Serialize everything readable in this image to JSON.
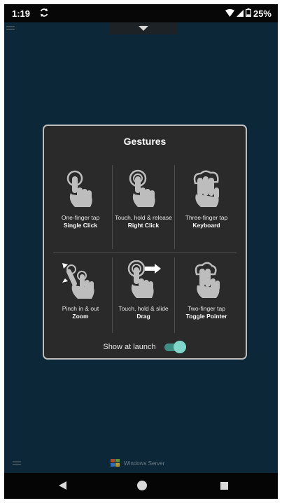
{
  "status_bar": {
    "time": "1:19",
    "battery": "25%"
  },
  "dialog": {
    "title": "Gestures",
    "gestures": [
      {
        "caption": "One-finger tap",
        "action": "Single Click",
        "icon": "one-finger-tap-icon"
      },
      {
        "caption": "Touch, hold & release",
        "action": "Right Click",
        "icon": "touch-hold-release-icon"
      },
      {
        "caption": "Three-finger tap",
        "action": "Keyboard",
        "icon": "three-finger-tap-icon"
      },
      {
        "caption": "Pinch in & out",
        "action": "Zoom",
        "icon": "pinch-icon"
      },
      {
        "caption": "Touch, hold & slide",
        "action": "Drag",
        "icon": "touch-hold-slide-icon"
      },
      {
        "caption": "Two-finger tap",
        "action": "Toggle Pointer",
        "icon": "two-finger-tap-icon"
      }
    ],
    "show_at_launch": {
      "label": "Show at launch",
      "enabled": true
    }
  },
  "footer": {
    "brand": "Windows Server"
  },
  "colors": {
    "background": "#0c2738",
    "dialog": "#2a2a2a",
    "toggle_accent": "#7fd6c9"
  }
}
